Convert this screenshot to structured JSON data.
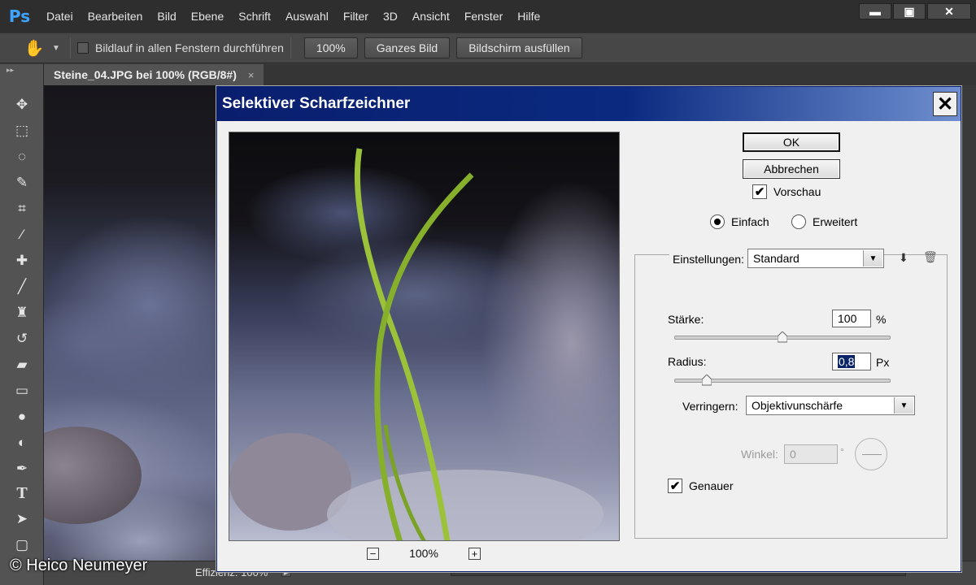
{
  "app": {
    "logo": "Ps"
  },
  "menu": [
    "Datei",
    "Bearbeiten",
    "Bild",
    "Ebene",
    "Schrift",
    "Auswahl",
    "Filter",
    "3D",
    "Ansicht",
    "Fenster",
    "Hilfe"
  ],
  "window_controls": {
    "minimize": "▬",
    "maximize": "▣",
    "close": "✕"
  },
  "options_bar": {
    "scroll_all_label": "Bildlauf in allen Fenstern durchführen",
    "scroll_all_checked": false,
    "buttons": [
      "100%",
      "Ganzes Bild",
      "Bildschirm ausfüllen"
    ]
  },
  "document_tab": {
    "title": "Steine_04.JPG bei 100% (RGB/8#)",
    "close": "×"
  },
  "tools": [
    "move-icon",
    "marquee-icon",
    "lasso-icon",
    "quick-selection-icon",
    "crop-icon",
    "eyedropper-icon",
    "healing-brush-icon",
    "brush-icon",
    "clone-stamp-icon",
    "history-brush-icon",
    "eraser-icon",
    "gradient-icon",
    "blur-icon",
    "dodge-icon",
    "pen-icon",
    "type-icon",
    "path-selection-icon",
    "shape-icon"
  ],
  "status_bar": {
    "text": "Effizienz: 100%"
  },
  "watermark": "© Heico Neumeyer",
  "dialog": {
    "title": "Selektiver Scharfzeichner",
    "close": "✕",
    "ok_label": "OK",
    "cancel_label": "Abbrechen",
    "preview_label": "Vorschau",
    "preview_checked": true,
    "zoom_value": "100%",
    "zoom_out": "−",
    "zoom_in": "+",
    "mode_simple": "Einfach",
    "mode_advanced": "Erweitert",
    "mode_selected": "Einfach",
    "settings_label": "Einstellungen:",
    "settings_value": "Standard",
    "amount_label": "Stärke:",
    "amount_value": "100",
    "amount_unit": "%",
    "amount_level": 0.5,
    "radius_label": "Radius:",
    "radius_value": "0,8",
    "radius_unit": "Px",
    "radius_level": 0.13,
    "remove_label": "Verringern:",
    "remove_value": "Objektivunschärfe",
    "angle_label": "Winkel:",
    "angle_value": "0",
    "angle_unit": "°",
    "more_accurate_label": "Genauer",
    "more_accurate_checked": true
  }
}
